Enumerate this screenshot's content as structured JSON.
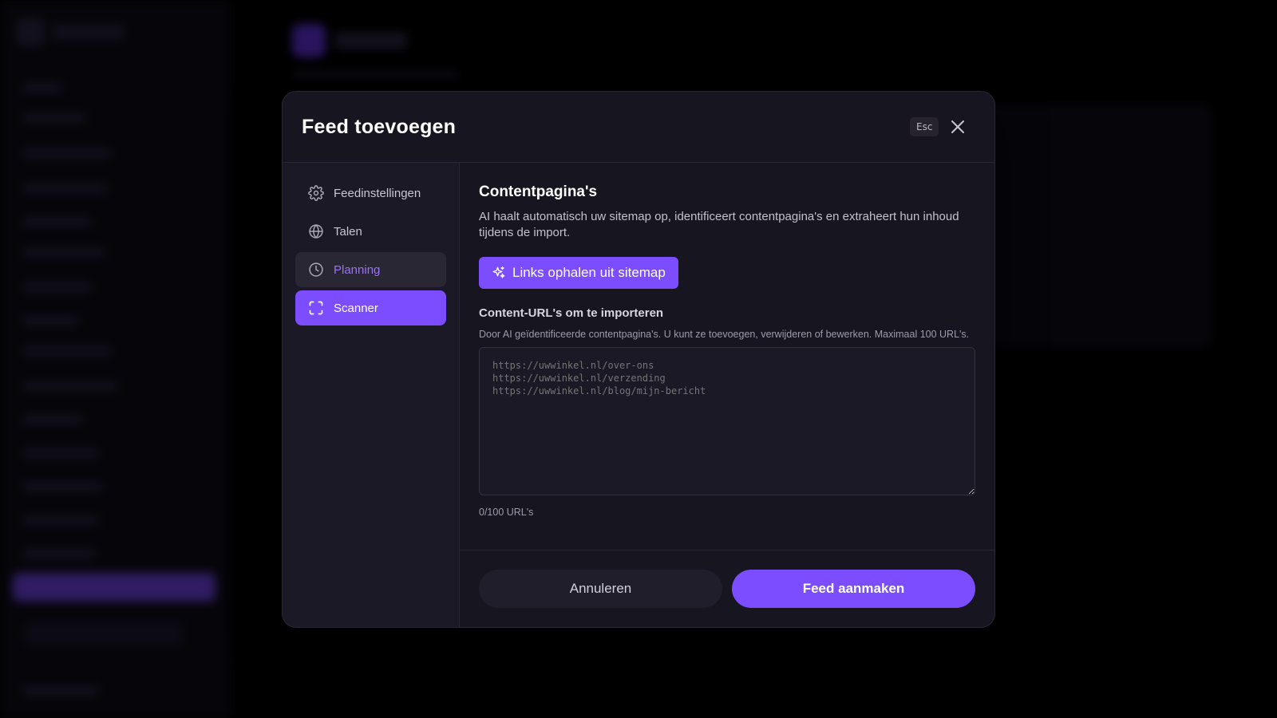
{
  "modal": {
    "title": "Feed toevoegen",
    "esc_label": "Esc"
  },
  "nav": {
    "items": [
      {
        "label": "Feedinstellingen",
        "icon": "gear-icon"
      },
      {
        "label": "Talen",
        "icon": "globe-icon"
      },
      {
        "label": "Planning",
        "icon": "clock-icon"
      },
      {
        "label": "Scanner",
        "icon": "scan-frame-icon",
        "active": true
      }
    ]
  },
  "content": {
    "title": "Contentpagina's",
    "description": "AI haalt automatisch uw sitemap op, identificeert contentpagina's en extraheert hun inhoud tijdens de import.",
    "sitemap_button": "Links ophalen uit sitemap",
    "field_label": "Content-URL's om te importeren",
    "field_help": "Door AI geïdentificeerde contentpagina's. U kunt ze toevoegen, verwijderen of bewerken. Maximaal 100 URL's.",
    "placeholder": "https://uwwinkel.nl/over-ons\nhttps://uwwinkel.nl/verzending\nhttps://uwwinkel.nl/blog/mijn-bericht",
    "counter": "0/100 URL's"
  },
  "footer": {
    "cancel": "Annuleren",
    "create": "Feed aanmaken"
  },
  "colors": {
    "accent": "#7c4dff",
    "modal_bg": "#17151f",
    "planning_text": "#9a72f2"
  }
}
